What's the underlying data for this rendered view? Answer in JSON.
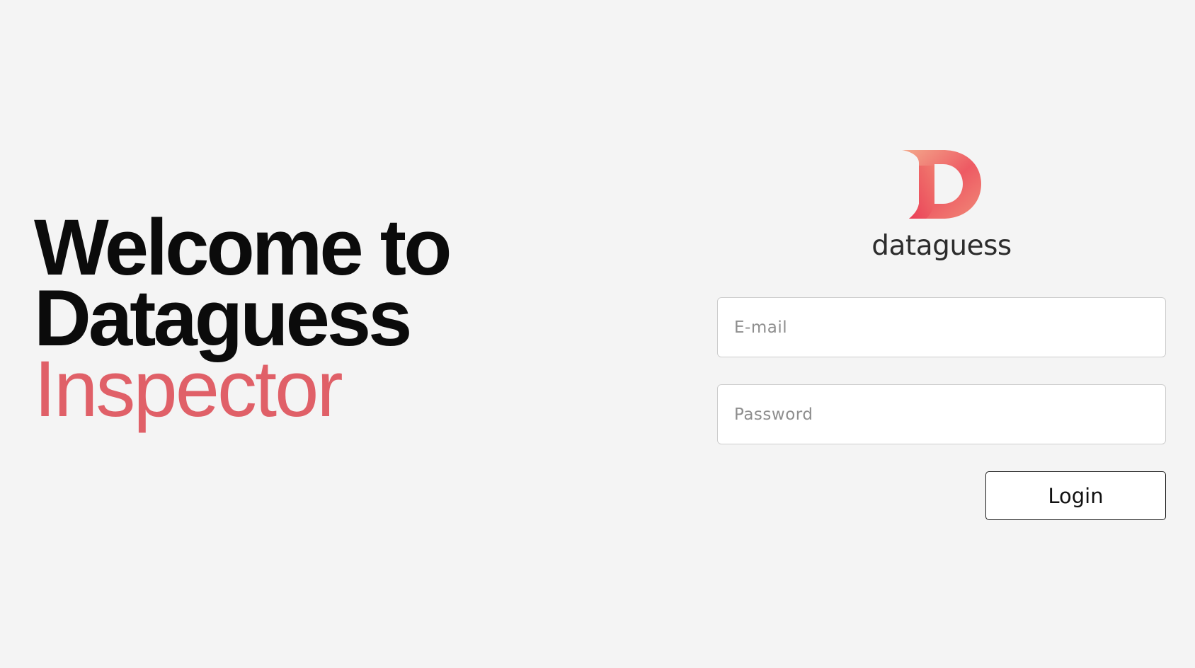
{
  "hero": {
    "line1": "Welcome to",
    "line2": "Dataguess",
    "line3": "Inspector"
  },
  "brand": {
    "logo_icon": "dataguess-d-logo-icon",
    "wordmark": "dataguess"
  },
  "form": {
    "email_placeholder": "E-mail",
    "email_value": "",
    "password_placeholder": "Password",
    "password_value": "",
    "login_label": "Login"
  },
  "colors": {
    "background": "#f4f4f4",
    "heading": "#0b0b0b",
    "accent": "#e06068",
    "logo_gradient_start": "#f3a98c",
    "logo_gradient_end": "#ea3e57"
  }
}
